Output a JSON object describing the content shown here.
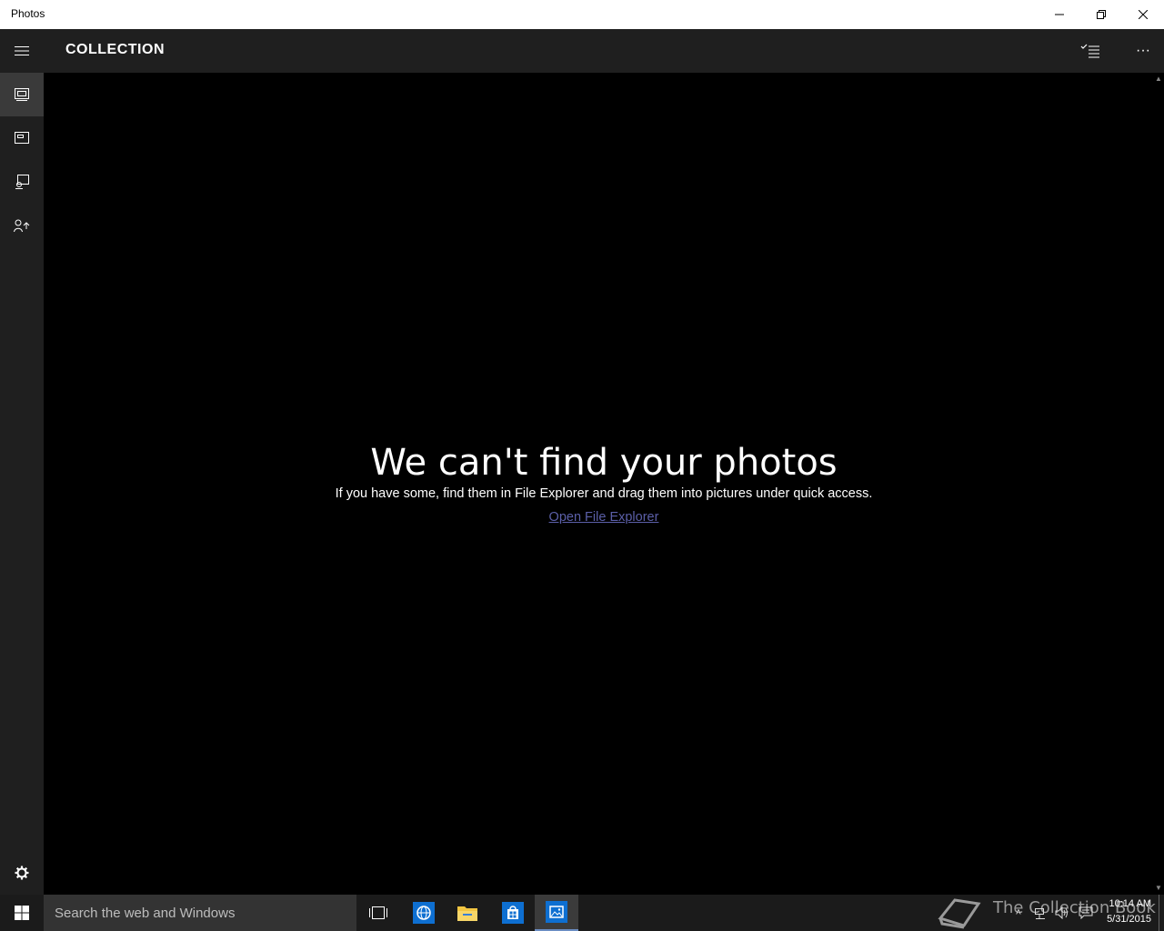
{
  "window": {
    "title": "Photos",
    "minimize_icon": "minimize-icon",
    "maximize_icon": "restore-icon",
    "close_icon": "close-icon"
  },
  "header": {
    "menu_icon": "hamburger-icon",
    "title": "COLLECTION",
    "select_icon": "select-list-icon",
    "more_label": "···"
  },
  "nav": {
    "items": [
      {
        "name": "collection",
        "icon": "collection-icon",
        "active": true
      },
      {
        "name": "albums",
        "icon": "albums-icon",
        "active": false
      },
      {
        "name": "folders",
        "icon": "folders-icon",
        "active": false
      },
      {
        "name": "import",
        "icon": "import-icon",
        "active": false
      }
    ],
    "settings_icon": "gear-icon"
  },
  "empty_state": {
    "heading": "We can't find your photos",
    "subtext": "If you have some, find them in File Explorer and drag them into pictures under quick access.",
    "link": "Open File Explorer"
  },
  "taskbar": {
    "search_placeholder": "Search the web and Windows",
    "apps": [
      "task-view",
      "internet-explorer",
      "file-explorer",
      "store",
      "photos"
    ],
    "watermark": "The Collection Book",
    "time": "10:14 AM",
    "date": "5/31/2015"
  },
  "colors": {
    "titlebar_bg": "#ffffff",
    "chrome_bg": "#1f1f1f",
    "content_bg": "#000000",
    "link": "#5b5fa8",
    "taskbar_bg": "#1b1b1b"
  }
}
